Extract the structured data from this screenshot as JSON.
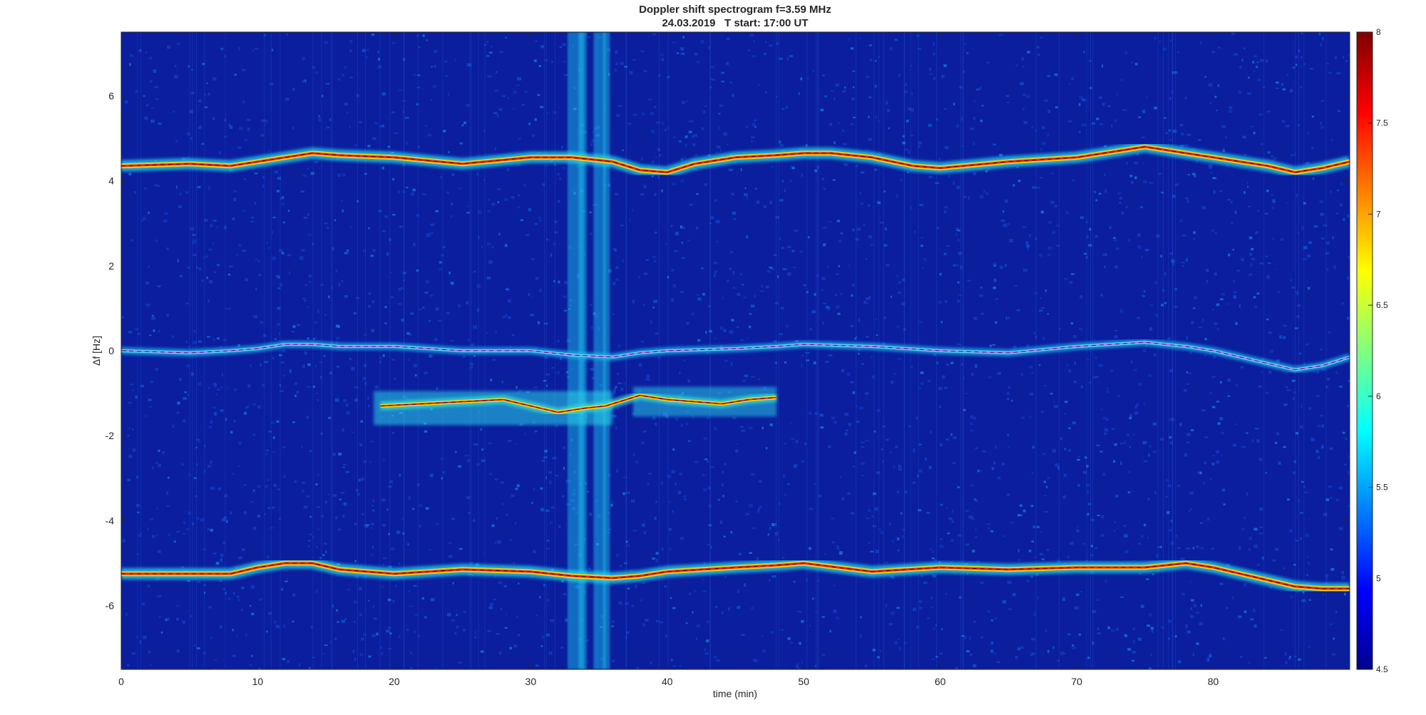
{
  "chart_data": {
    "type": "heatmap",
    "title": "Doppler shift spectrogram f=3.59 MHz",
    "subtitle": "24.03.2019   T start: 17:00 UT",
    "xlabel": "time (min)",
    "ylabel": "Δf [Hz]",
    "xlim": [
      0,
      90
    ],
    "ylim": [
      -7.5,
      7.5
    ],
    "xticks": [
      0,
      10,
      20,
      30,
      40,
      50,
      60,
      70,
      80
    ],
    "yticks": [
      -6,
      -4,
      -2,
      0,
      2,
      4,
      6
    ],
    "colormap": "jet",
    "colorbar": {
      "clim": [
        4.5,
        8
      ],
      "ticks": [
        4.5,
        5,
        5.5,
        6,
        6.5,
        7,
        7.5,
        8
      ]
    },
    "series": [
      {
        "x": [
          0,
          5,
          8,
          10,
          12,
          14,
          16,
          20,
          25,
          30,
          33,
          36,
          38,
          40,
          42,
          45,
          48,
          50,
          52,
          55,
          58,
          60,
          65,
          70,
          75,
          78,
          80,
          82,
          84,
          86,
          88,
          90
        ],
        "y": [
          4.35,
          4.4,
          4.35,
          4.45,
          4.55,
          4.65,
          4.6,
          4.55,
          4.4,
          4.55,
          4.55,
          4.45,
          4.25,
          4.2,
          4.4,
          4.55,
          4.6,
          4.65,
          4.65,
          4.55,
          4.35,
          4.3,
          4.45,
          4.55,
          4.8,
          4.65,
          4.55,
          4.45,
          4.35,
          4.2,
          4.3,
          4.45
        ]
      },
      {
        "x": [
          0,
          5,
          8,
          10,
          12,
          14,
          16,
          20,
          25,
          30,
          33,
          36,
          38,
          40,
          45,
          48,
          50,
          55,
          60,
          65,
          70,
          75,
          78,
          80,
          82,
          84,
          86,
          88,
          90
        ],
        "y": [
          0.0,
          -0.05,
          0.0,
          0.05,
          0.15,
          0.15,
          0.1,
          0.1,
          0.0,
          0.0,
          -0.1,
          -0.15,
          -0.05,
          0.0,
          0.05,
          0.1,
          0.15,
          0.1,
          0.0,
          -0.05,
          0.1,
          0.2,
          0.1,
          0.0,
          -0.15,
          -0.3,
          -0.45,
          -0.35,
          -0.15
        ]
      },
      {
        "x": [
          19,
          22,
          25,
          28,
          30,
          32,
          34,
          35.5,
          38,
          40,
          42,
          44,
          46,
          48
        ],
        "y": [
          -1.3,
          -1.25,
          -1.2,
          -1.15,
          -1.3,
          -1.45,
          -1.35,
          -1.3,
          -1.05,
          -1.15,
          -1.2,
          -1.25,
          -1.15,
          -1.1
        ]
      },
      {
        "x": [
          0,
          5,
          8,
          10,
          12,
          14,
          16,
          20,
          25,
          30,
          33,
          36,
          38,
          40,
          45,
          48,
          50,
          55,
          60,
          65,
          70,
          75,
          78,
          80,
          82,
          84,
          86,
          88,
          90
        ],
        "y": [
          -5.25,
          -5.25,
          -5.25,
          -5.1,
          -5.0,
          -5.0,
          -5.15,
          -5.25,
          -5.15,
          -5.2,
          -5.3,
          -5.35,
          -5.3,
          -5.2,
          -5.1,
          -5.05,
          -5.0,
          -5.2,
          -5.1,
          -5.15,
          -5.1,
          -5.1,
          -5.0,
          -5.1,
          -5.25,
          -5.4,
          -5.55,
          -5.6,
          -5.6
        ]
      }
    ]
  }
}
